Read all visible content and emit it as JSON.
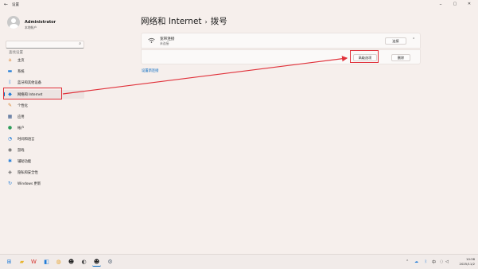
{
  "window": {
    "title": "设置",
    "back": "←",
    "minimize": "–",
    "maximize": "▢",
    "close": "✕"
  },
  "user": {
    "name": "Administrator",
    "account": "本地帐户"
  },
  "search": {
    "placeholder": "查找设置",
    "icon": "search-icon"
  },
  "sidebar": {
    "items": [
      {
        "label": "主页",
        "icon": "home-icon",
        "glyph": "⌂",
        "color": "#d9822b"
      },
      {
        "label": "系统",
        "icon": "monitor-icon",
        "glyph": "▬",
        "color": "#1f7bd8"
      },
      {
        "label": "蓝牙和其他设备",
        "icon": "bluetooth-icon",
        "glyph": "ᛒ",
        "color": "#1f7bd8"
      },
      {
        "label": "网络和 Internet",
        "icon": "wifi-icon",
        "glyph": "◆",
        "color": "#1f7bd8"
      },
      {
        "label": "个性化",
        "icon": "brush-icon",
        "glyph": "✎",
        "color": "#d9822b"
      },
      {
        "label": "应用",
        "icon": "apps-icon",
        "glyph": "▦",
        "color": "#3b5b8c"
      },
      {
        "label": "帐户",
        "icon": "person-icon",
        "glyph": "●",
        "color": "#2e9e5b"
      },
      {
        "label": "时间和语言",
        "icon": "globe-clock-icon",
        "glyph": "◔",
        "color": "#1f7bd8"
      },
      {
        "label": "游戏",
        "icon": "gamepad-icon",
        "glyph": "◉",
        "color": "#6b6b6b"
      },
      {
        "label": "辅助功能",
        "icon": "accessibility-icon",
        "glyph": "✱",
        "color": "#1f7bd8"
      },
      {
        "label": "隐私和安全性",
        "icon": "shield-icon",
        "glyph": "◈",
        "color": "#6b6b6b"
      },
      {
        "label": "Windows 更新",
        "icon": "update-icon",
        "glyph": "↻",
        "color": "#1f7bd8"
      }
    ]
  },
  "breadcrumb": {
    "parent": "网络和 Internet",
    "separator": "›",
    "current": "拨号"
  },
  "connection": {
    "title": "宽带连接",
    "status": "未连接",
    "connect_label": "连接",
    "advanced_label": "高级选项",
    "delete_label": "删除"
  },
  "new_connection_link": "设置新连接",
  "annotation_color": "#e0313a",
  "taskbar": {
    "time": "10:38",
    "date": "2025/11/2",
    "tray_ime": "中",
    "icons": [
      {
        "name": "start-icon",
        "glyph": "⊞",
        "color": "#1f7bd8"
      },
      {
        "name": "file-explorer-icon",
        "glyph": "▰",
        "color": "#e8b530"
      },
      {
        "name": "wps-icon",
        "glyph": "W",
        "color": "#d6322c"
      },
      {
        "name": "store-icon",
        "glyph": "◧",
        "color": "#1f7bd8"
      },
      {
        "name": "chrome-icon",
        "glyph": "◍",
        "color": "#e8a530"
      },
      {
        "name": "qq-icon",
        "glyph": "☻",
        "color": "#222222"
      },
      {
        "name": "app-icon",
        "glyph": "◐",
        "color": "#4a4a4a"
      },
      {
        "name": "qq-active-icon",
        "glyph": "☻",
        "color": "#222222"
      },
      {
        "name": "settings-gear-icon",
        "glyph": "⚙",
        "color": "#5a6b7c"
      }
    ]
  }
}
